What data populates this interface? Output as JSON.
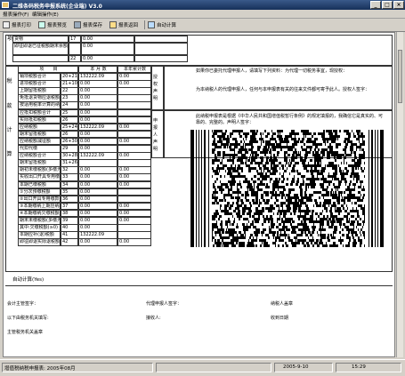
{
  "window": {
    "title": "二维条码税务申报系统(企业端) V3.0",
    "min": "_",
    "max": "□",
    "close": "×"
  },
  "menu": [
    "报表操作(F)",
    "编辑操作(E)"
  ],
  "toolbar": {
    "print": "报表打印",
    "preview": "报表预览",
    "save": "报表保存",
    "back": "报表返回",
    "calc": "自动计算"
  },
  "form": {
    "top_rows": [
      {
        "label": "货物",
        "col": "17",
        "value": "0.00"
      },
      {
        "label": "即征即退已征税额期末余额",
        "col": "",
        "value": "0.00"
      },
      {
        "label": "",
        "col": "22",
        "value": "0.00"
      }
    ],
    "headers": {
      "item": "项　　目",
      "period": "本 月 数",
      "ytd": "本年累计数"
    },
    "section_labels": {
      "a": "项",
      "b": "税",
      "c": "款",
      "d": "计",
      "e": "算"
    },
    "rows": [
      {
        "name": "销项税额合计",
        "no": "20+21",
        "val": "132222.09",
        "ytd": "0.00"
      },
      {
        "name": "进项税额合计",
        "no": "21+10+13",
        "val": "0.00",
        "ytd": "0.00"
      },
      {
        "name": "上期留抵税额",
        "no": "22",
        "val": "0.00",
        "ytd": ""
      },
      {
        "name": "免抵退货物应退税额",
        "no": "23",
        "val": "0.00",
        "ytd": ""
      },
      {
        "name": "按适用税率计算的纳税检查应补缴税额",
        "no": "24",
        "val": "0.00",
        "ytd": ""
      },
      {
        "name": "应抵扣税额合计",
        "no": "25",
        "val": "0.00",
        "ytd": ""
      },
      {
        "name": "实际抵扣税额",
        "no": "26",
        "val": "0.00",
        "ytd": ""
      },
      {
        "name": "应纳税额",
        "no": "25+24+25",
        "val": "132222.09",
        "ytd": "0.00"
      },
      {
        "name": "期末留抵税额",
        "no": "26",
        "val": "0.00",
        "ytd": ""
      },
      {
        "name": "应纳税额减征额",
        "no": "26+30+26+27",
        "val": "0.00",
        "ytd": "0.00"
      },
      {
        "name": "代扣代缴",
        "no": "29",
        "val": "0.00",
        "ytd": ""
      },
      {
        "name": "应纳税额合计",
        "no": "30+28+29",
        "val": "132222.09",
        "ytd": "0.00"
      },
      {
        "name": "期末留抵税额",
        "no": "31+26-27",
        "val": "",
        "ytd": ""
      },
      {
        "name": "期初未缴税额(多缴为负数)",
        "no": "32",
        "val": "0.00",
        "ytd": "0.00"
      },
      {
        "name": "实收出口开具专用缴款书退税额",
        "no": "33",
        "val": "0.00",
        "ytd": "0.00"
      },
      {
        "name": "本期已缴税额",
        "no": "34",
        "val": "0.00",
        "ytd": "0.00"
      },
      {
        "name": "①分次预缴税额",
        "no": "35",
        "val": "0.00",
        "ytd": ""
      },
      {
        "name": "②出口开具专用缴款书预缴税额",
        "no": "36",
        "val": "0.00",
        "ytd": ""
      },
      {
        "name": "③本期缴纳上期应纳税额",
        "no": "37",
        "val": "0.00",
        "ytd": "0.00"
      },
      {
        "name": "④本期缴纳欠缴税额",
        "no": "38",
        "val": "0.00",
        "ytd": "0.00"
      },
      {
        "name": "期末未缴税额(多缴为负数)",
        "no": "39",
        "val": "0.00",
        "ytd": "0.00"
      },
      {
        "name": "其中:欠缴税额(≥0)",
        "no": "40",
        "val": "0.00",
        "ytd": ""
      },
      {
        "name": "本期应补(退)税额",
        "no": "41",
        "val": "132222.09",
        "ytd": ""
      },
      {
        "name": "即征即退实际退税额",
        "no": "42",
        "val": "0.00",
        "ytd": "0.00"
      }
    ],
    "auth": {
      "side1": "授权声明",
      "side2": "申报人声明",
      "text1": "如果你已委托代理申报人，请填写下列资料：为代理一切税务事宜，现授权：",
      "text2": "为本纳税人的代理申报人，任何与本申报表有关的往来文件都可寄予此人。授权人签字：",
      "text3": "此纳税申报表是根据《中华人民共和国增值税暂行条例》的规定填报的，我确信它是真实的、可靠的、完整的。声明人签字："
    },
    "auto_calc": "自动计算(Yes)",
    "footer": {
      "a1": "会计主管签字：",
      "a2": "代理申报人签字：",
      "a3": "纳税人盖章",
      "b1": "以下由税务机关填写:",
      "b2": "接收人:",
      "b3": "收到日期",
      "c1": "主管税务机关盖章"
    }
  },
  "status": {
    "left": "增值税纳税申报表: 2005年08月",
    "date": "2005-9-10",
    "time": "15:29"
  },
  "colors": {
    "titlebar": "#16305a",
    "chrome": "#d4d0c8",
    "paper": "#ffffff"
  }
}
